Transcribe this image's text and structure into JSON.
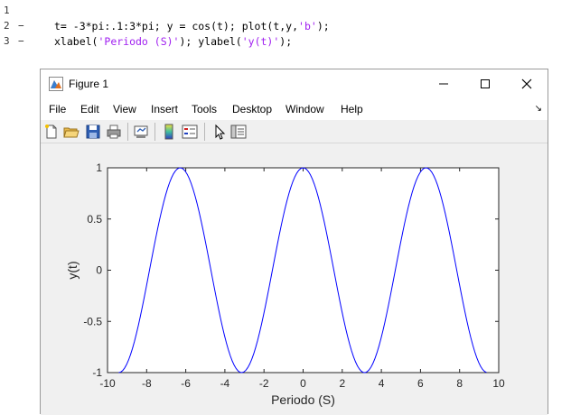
{
  "editor": {
    "lines": [
      {
        "num": "1",
        "dash": "",
        "code": ""
      },
      {
        "num": "2",
        "dash": "−",
        "code_parts": [
          {
            "text": "t= -3*pi:.1:3*pi; y = cos(t); plot(t,y,",
            "type": "code"
          },
          {
            "text": "'b'",
            "type": "string"
          },
          {
            "text": ");",
            "type": "code"
          }
        ]
      },
      {
        "num": "3",
        "dash": "−",
        "code_parts": [
          {
            "text": "xlabel(",
            "type": "code"
          },
          {
            "text": "'Periodo (S)'",
            "type": "string"
          },
          {
            "text": "); ylabel(",
            "type": "code"
          },
          {
            "text": "'y(t)'",
            "type": "string"
          },
          {
            "text": ");",
            "type": "code"
          }
        ]
      }
    ]
  },
  "figure": {
    "title": "Figure 1",
    "window_controls": {
      "minimize": "minimize",
      "maximize": "maximize",
      "close": "close"
    },
    "menu": [
      "File",
      "Edit",
      "View",
      "Insert",
      "Tools",
      "Desktop",
      "Window",
      "Help"
    ],
    "menu_overflow_icon": "dock-arrow-icon",
    "toolbar": [
      "new-figure-icon",
      "open-file-icon",
      "save-icon",
      "print-icon",
      "link-plot-icon",
      "colorbar-icon",
      "legend-icon",
      "edit-pointer-icon",
      "property-inspector-icon"
    ]
  },
  "colors": {
    "line": "#0000ff",
    "string": "#a020f0",
    "axes_text": "#262626"
  },
  "chart_data": {
    "type": "line",
    "title": "",
    "xlabel": "Periodo (S)",
    "ylabel": "y(t)",
    "xlim": [
      -10,
      10
    ],
    "ylim": [
      -1,
      1
    ],
    "xticks": [
      -10,
      -8,
      -6,
      -4,
      -2,
      0,
      2,
      4,
      6,
      8,
      10
    ],
    "yticks": [
      -1,
      -0.5,
      0,
      0.5,
      1
    ],
    "xtick_labels": [
      "-10",
      "-8",
      "-6",
      "-4",
      "-2",
      "0",
      "2",
      "4",
      "6",
      "8",
      "10"
    ],
    "ytick_labels": [
      "-1",
      "-0.5",
      "0",
      "0.5",
      "1"
    ],
    "grid": false,
    "series": [
      {
        "function": "cos(t)",
        "x_start": -9.4248,
        "x_end": 9.4248,
        "x_step": 0.1,
        "color": "#0000ff"
      }
    ]
  }
}
